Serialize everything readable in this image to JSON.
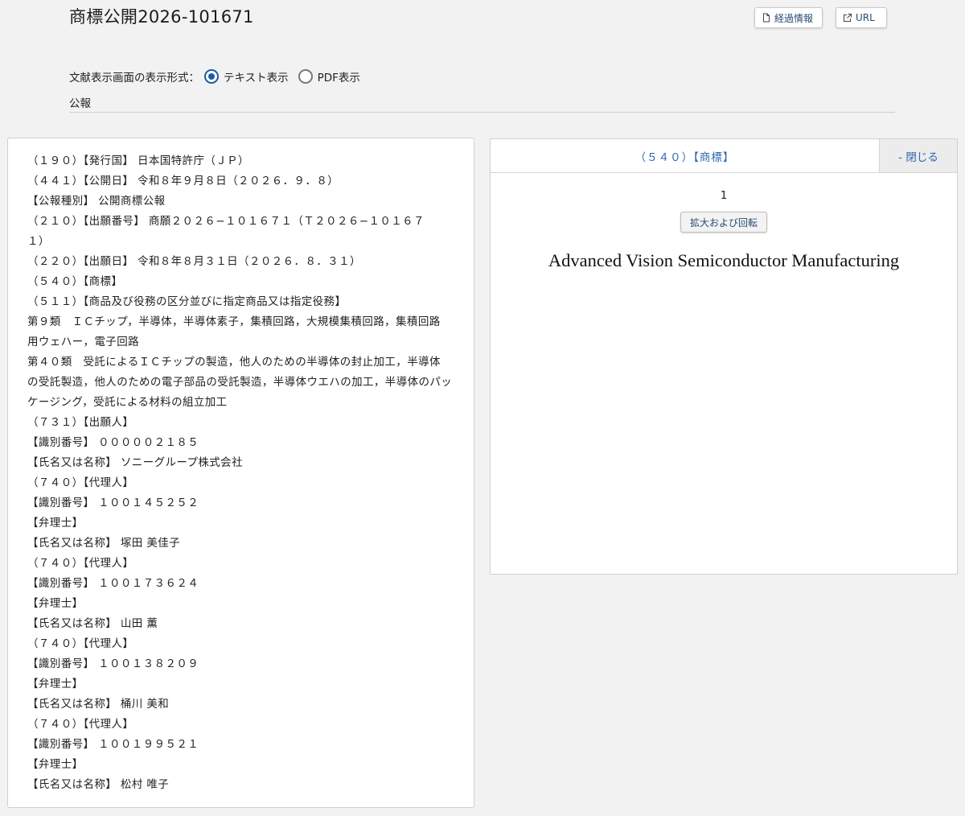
{
  "header": {
    "title": "商標公開2026-101671",
    "history_label": "経過情報",
    "url_label": "URL"
  },
  "format": {
    "label": "文献表示画面の表示形式：",
    "options": [
      "テキスト表示",
      "PDF表示"
    ],
    "selected": "テキスト表示"
  },
  "section_label": "公報",
  "document": {
    "lines": [
      "（１９０）【発行国】 日本国特許庁（ＪＰ）",
      "（４４１）【公開日】 令和８年９月８日（２０２６．９．８）",
      "【公報種別】 公開商標公報",
      "（２１０）【出願番号】 商願２０２６−１０１６７１（Ｔ２０２６−１０１６７",
      "１）",
      "（２２０）【出願日】 令和８年８月３１日（２０２６．８．３１）",
      "（５４０）【商標】",
      "（５１１）【商品及び役務の区分並びに指定商品又は指定役務】",
      "第９類　ＩＣチップ，半導体，半導体素子，集積回路，大規模集積回路，集積回路",
      "用ウェハー，電子回路",
      "第４０類　受託によるＩＣチップの製造，他人のための半導体の封止加工，半導体",
      "の受託製造，他人のための電子部品の受託製造，半導体ウエハの加工，半導体のパッ",
      "ケージング，受託による材料の組立加工",
      "（７３１）【出願人】",
      "【識別番号】 ０００００２１８５",
      "【氏名又は名称】 ソニーグループ株式会社",
      "（７４０）【代理人】",
      "【識別番号】 １００１４５２５２",
      "【弁理士】",
      "【氏名又は名称】 塚田 美佳子",
      "（７４０）【代理人】",
      "【識別番号】 １００１７３６２４",
      "【弁理士】",
      "【氏名又は名称】 山田 薫",
      "（７４０）【代理人】",
      "【識別番号】 １００１３８２０９",
      "【弁理士】",
      "【氏名又は名称】 桶川 美和",
      "（７４０）【代理人】",
      "【識別番号】 １００１９９５２１",
      "【弁理士】",
      "【氏名又は名称】 松村 唯子"
    ]
  },
  "trademark_panel": {
    "title": "（５４０）【商標】",
    "close_label": "- 閉じる",
    "page_number": "1",
    "zoom_label": "拡大および回転",
    "mark_text": "Advanced Vision Semiconductor Manufacturing"
  },
  "colors": {
    "link": "#2f67b2",
    "radio_selected": "#1f5aa6"
  }
}
